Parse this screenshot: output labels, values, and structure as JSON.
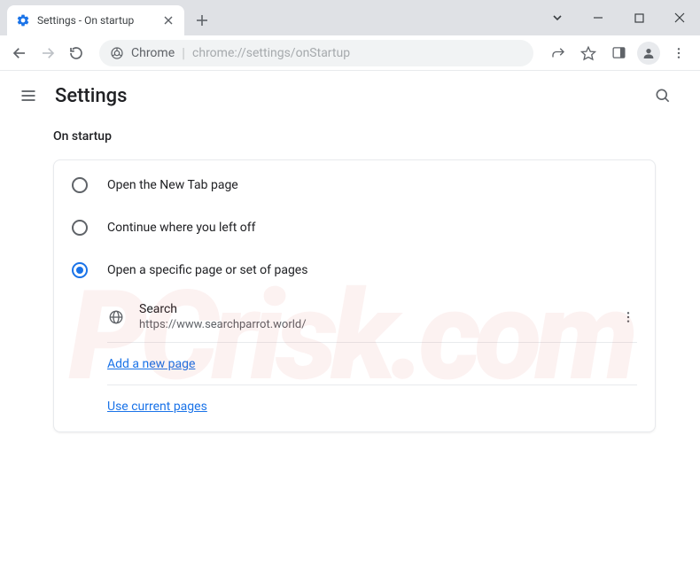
{
  "tab": {
    "title": "Settings - On startup"
  },
  "omnibox": {
    "origin": "Chrome",
    "path": "chrome://settings/onStartup"
  },
  "header": {
    "title": "Settings"
  },
  "section": {
    "title": "On startup"
  },
  "options": {
    "opt1": "Open the New Tab page",
    "opt2": "Continue where you left off",
    "opt3": "Open a specific page or set of pages"
  },
  "pages": [
    {
      "title": "Search",
      "url": "https://www.searchparrot.world/"
    }
  ],
  "links": {
    "add": "Add a new page",
    "use_current": "Use current pages"
  }
}
